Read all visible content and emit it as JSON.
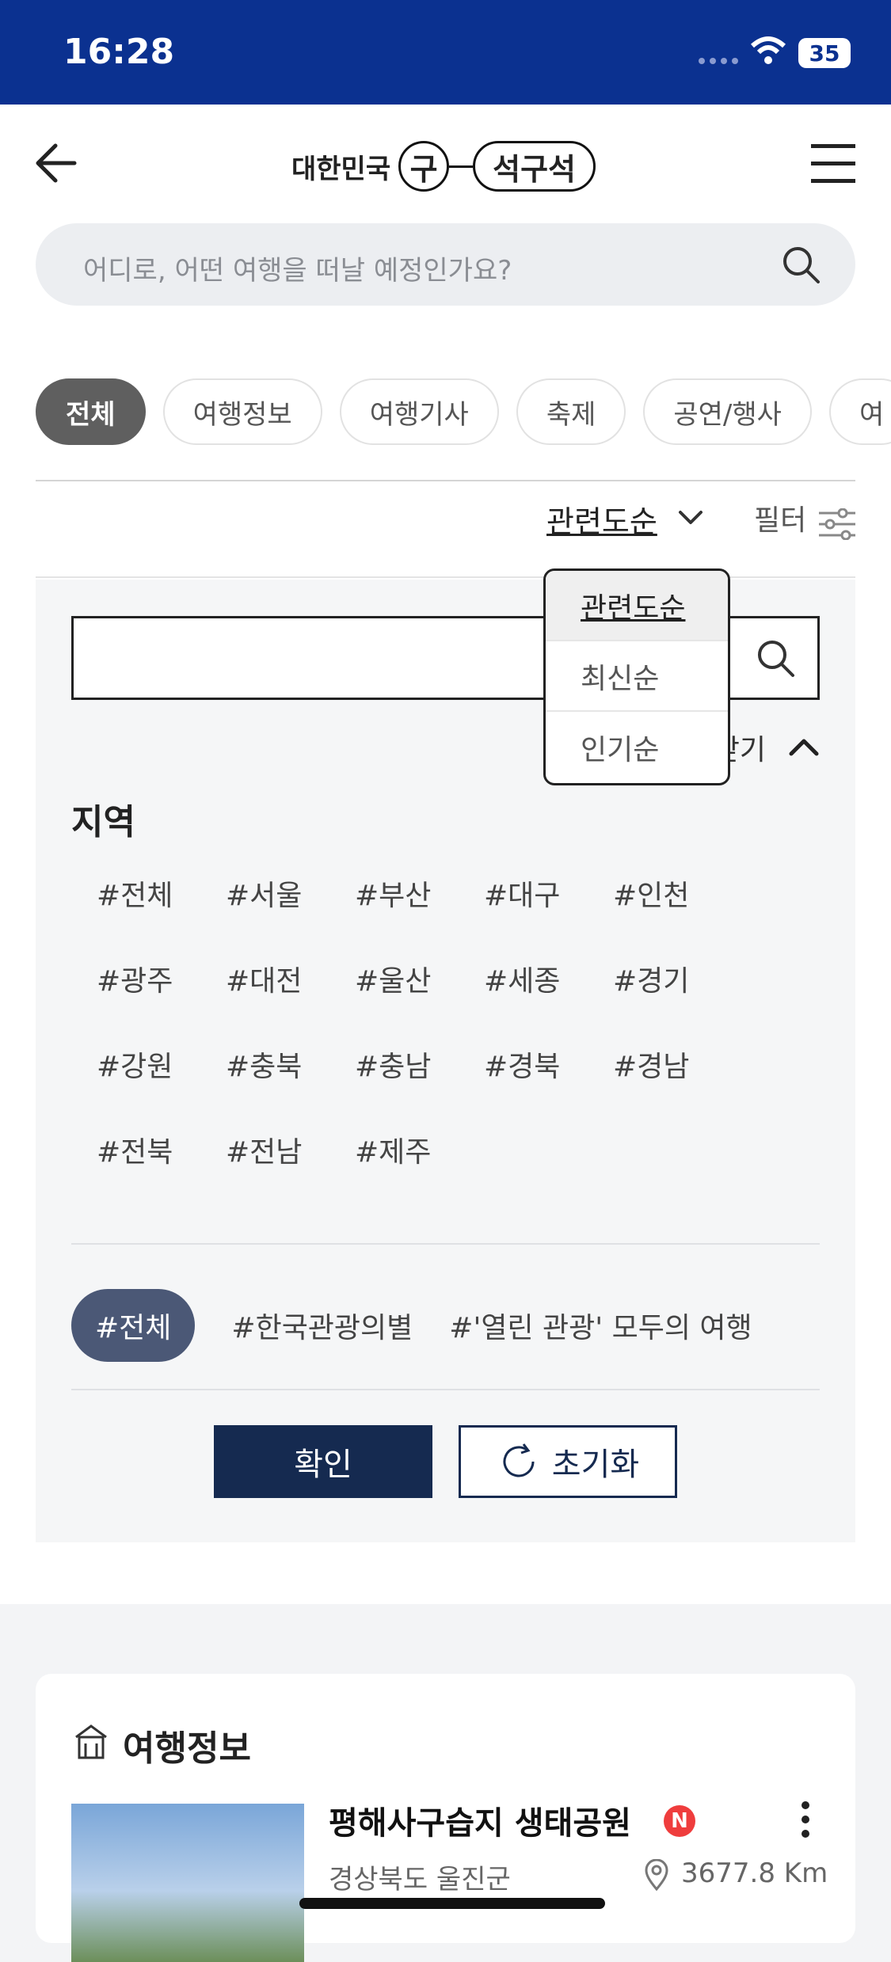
{
  "status_bar": {
    "time": "16:28",
    "battery": "35"
  },
  "header": {
    "logo": {
      "prefix": "대한민국",
      "circle_char": "구",
      "suffix": "석구석"
    },
    "search_placeholder": "어디로, 어떤 여행을 떠날 예정인가요?"
  },
  "category_tabs": [
    {
      "label": "전체",
      "active": true
    },
    {
      "label": "여행정보",
      "active": false
    },
    {
      "label": "여행기사",
      "active": false
    },
    {
      "label": "축제",
      "active": false
    },
    {
      "label": "공연/행사",
      "active": false
    },
    {
      "label": "여",
      "active": false
    }
  ],
  "sort": {
    "current": "관련도순",
    "filter_label": "필터"
  },
  "sort_dropdown": {
    "options": [
      {
        "label": "관련도순",
        "selected": true
      },
      {
        "label": "최신순",
        "selected": false
      },
      {
        "label": "인기순",
        "selected": false
      }
    ]
  },
  "filter_panel": {
    "input_value": "",
    "collapse_label": "닫기",
    "region_title": "지역",
    "regions": [
      "#전체",
      "#서울",
      "#부산",
      "#대구",
      "#인천",
      "#광주",
      "#대전",
      "#울산",
      "#세종",
      "#경기",
      "#강원",
      "#충북",
      "#충남",
      "#경북",
      "#경남",
      "#전북",
      "#전남",
      "#제주"
    ],
    "tags": [
      {
        "label": "#전체",
        "active": true
      },
      {
        "label": "#한국관광의별",
        "active": false
      },
      {
        "label": "#'열린 관광' 모두의 여행",
        "active": false
      }
    ],
    "confirm_label": "확인",
    "reset_label": "초기화"
  },
  "travel_section": {
    "title": "여행정보",
    "item": {
      "title": "평해사구습지 생태공원",
      "badge": "N",
      "location": "경상북도 울진군",
      "distance": "3677.8 Km"
    }
  },
  "colors": {
    "status_bar": "#0b3190",
    "primary_button": "#152a50",
    "active_tag": "#4b5876",
    "badge": "#ef3d3d"
  }
}
